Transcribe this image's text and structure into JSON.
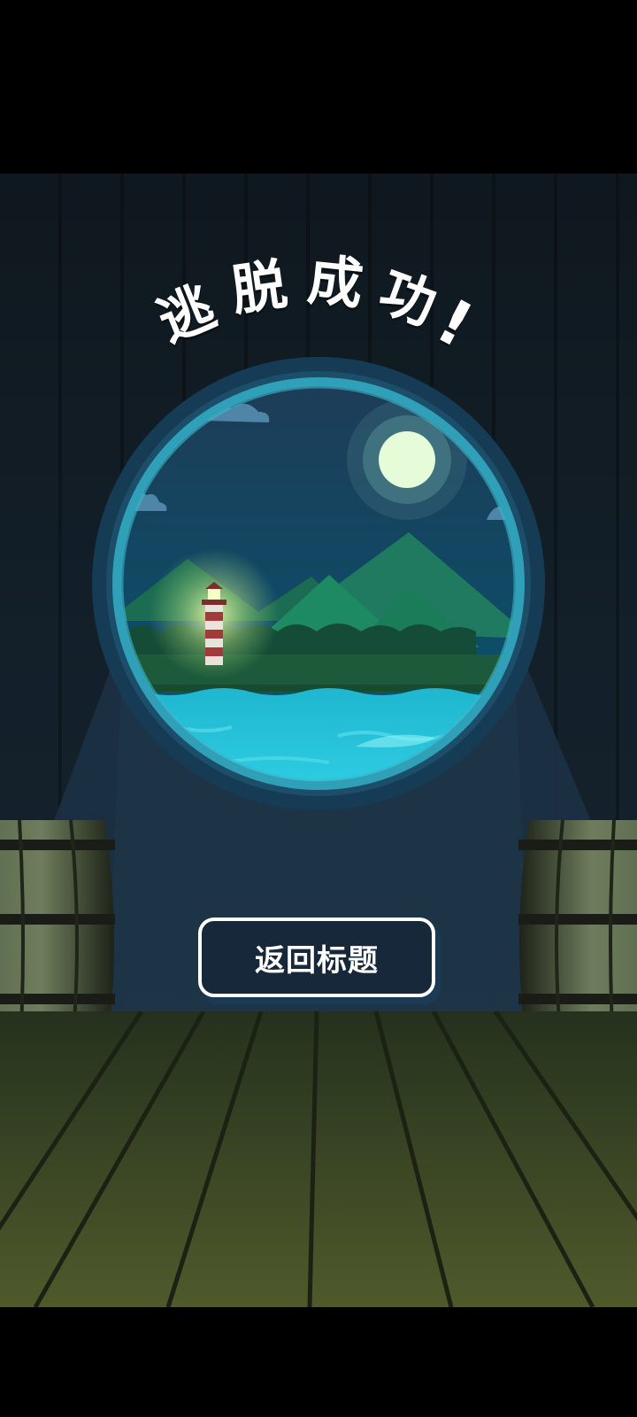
{
  "screen": {
    "title_chars": [
      "逃",
      "脱",
      "成",
      "功",
      "!"
    ],
    "back_button_label": "返回标题"
  },
  "colors": {
    "wall": "#131f29",
    "porthole_rim": "#163b55",
    "sea": "#29c7d8",
    "grass": "#1d5a3b",
    "moon": "#e6fbd7",
    "floor": "#3f4d25",
    "button_bg": "#17283a",
    "button_border": "#ffffff"
  },
  "icons": [
    "moon-icon",
    "lighthouse-icon",
    "cloud-icon",
    "barrel-icon"
  ]
}
